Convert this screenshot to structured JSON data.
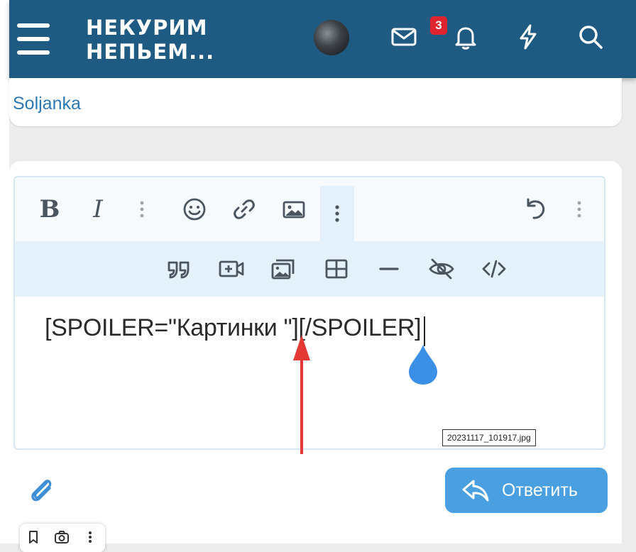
{
  "header": {
    "logo_line1": "НЕКУРИМ",
    "logo_line2": "НЕПЬЕМ...",
    "notification_count": "3",
    "background_color": "#1f5a82"
  },
  "icons": {
    "menu": "hamburger-icon",
    "avatar": "user-avatar",
    "messages": "envelope-icon",
    "alerts": "bell-icon",
    "whats_new": "lightning-icon",
    "search": "search-icon"
  },
  "user": {
    "name": "Soljanka"
  },
  "editor": {
    "text_content": "[SPOILER=\"Картинки \"][/SPOILER]",
    "filename_label": "20231117_101917.jpg",
    "toolbar_row1": [
      "bold-icon",
      "italic-icon",
      "more-options-icon",
      "smiley-icon",
      "link-icon",
      "image-icon",
      "more-vertical-icon",
      "undo-icon",
      "more-options-icon"
    ],
    "toolbar_row2": [
      "quote-icon",
      "insert-video-icon",
      "media-gallery-icon",
      "table-icon",
      "horizontal-line-icon",
      "spoiler-hide-icon",
      "code-icon"
    ],
    "bold_glyph": "B",
    "italic_glyph": "I"
  },
  "actions": {
    "reply_label": "Ответить",
    "reply_color": "#4a9fe0"
  },
  "colors": {
    "link": "#2e78b2",
    "annotation_arrow": "#e53935",
    "cursor_drop": "#3b8fe6"
  }
}
